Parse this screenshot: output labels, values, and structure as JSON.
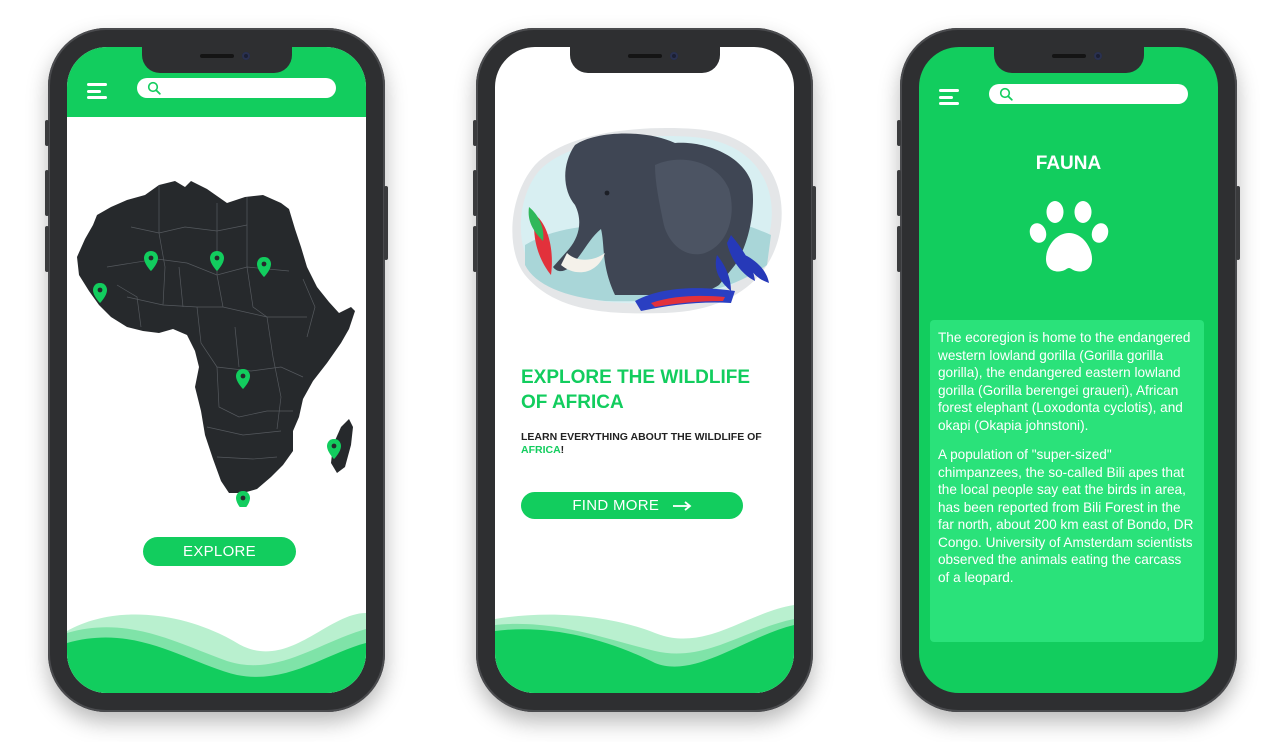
{
  "colors": {
    "brand_green": "#12cd5e",
    "card_green": "#2ae27a",
    "map_dark": "#26292c",
    "phone_body": "#2e2f31"
  },
  "screen_map": {
    "search": {
      "placeholder": "",
      "icon": "search-icon"
    },
    "menu_icon": "hamburger-menu-icon",
    "map_pins": [
      "map-pin-icon",
      "map-pin-icon",
      "map-pin-icon",
      "map-pin-icon",
      "map-pin-icon",
      "map-pin-icon",
      "map-pin-icon"
    ],
    "explore_button": "EXPLORE"
  },
  "screen_intro": {
    "heading": "EXPLORE THE WILDLIFE OF AFRICA",
    "subtitle_part1": "LEARN EVERYTHING ABOUT THE WILDLIFE OF ",
    "subtitle_highlight": "AFRICA",
    "subtitle_end": "!",
    "find_more_button": "FIND MORE",
    "arrow_icon": "arrow-right-icon"
  },
  "screen_fauna": {
    "search": {
      "placeholder": "",
      "icon": "search-icon"
    },
    "menu_icon": "hamburger-menu-icon",
    "title": "FAUNA",
    "paw_icon": "paw-icon",
    "paragraphs": [
      "The ecoregion is home to the endangered western lowland gorilla (Gorilla gorilla gorilla), the endangered eastern lowland gorilla (Gorilla berengei graueri), African forest elephant (Loxodonta cyclotis), and okapi (Okapia johnstoni).",
      "A population of \"super-sized\" chimpanzees, the so-called Bili apes that the local people say eat the birds in area, has been reported from Bili Forest in the far north, about 200 km east of Bondo, DR Congo. University of Amsterdam scientists observed  the animals eating the carcass of a leopard."
    ]
  }
}
